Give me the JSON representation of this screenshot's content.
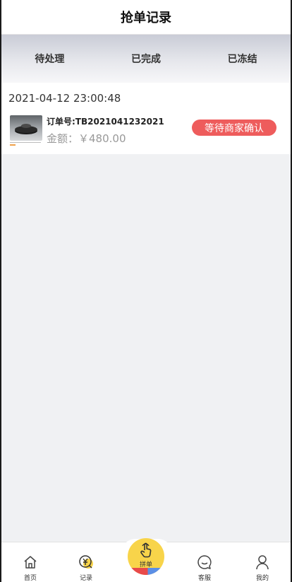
{
  "header": {
    "title": "抢单记录"
  },
  "tabs": [
    {
      "label": "待处理"
    },
    {
      "label": "已完成"
    },
    {
      "label": "已冻结"
    }
  ],
  "records": [
    {
      "time": "2021-04-12 23:00:48",
      "order_no": "订单号:TB2021041232021",
      "amount": "金额：￥480.00",
      "status": "等待商家确认"
    }
  ],
  "bottom_nav": {
    "home_label": "首页",
    "records_label": "记录",
    "grab_label": "拼单",
    "service_label": "客服",
    "mine_label": "我的"
  },
  "colors": {
    "status_badge": "#ee5c5c",
    "center_button": "#f8d44a",
    "page_background": "#f0f1f3"
  },
  "icons": {
    "home": "home-icon",
    "records": "yen-records-icon",
    "grab": "tap-hand-icon",
    "service": "chat-bubble-icon",
    "mine": "user-icon"
  }
}
